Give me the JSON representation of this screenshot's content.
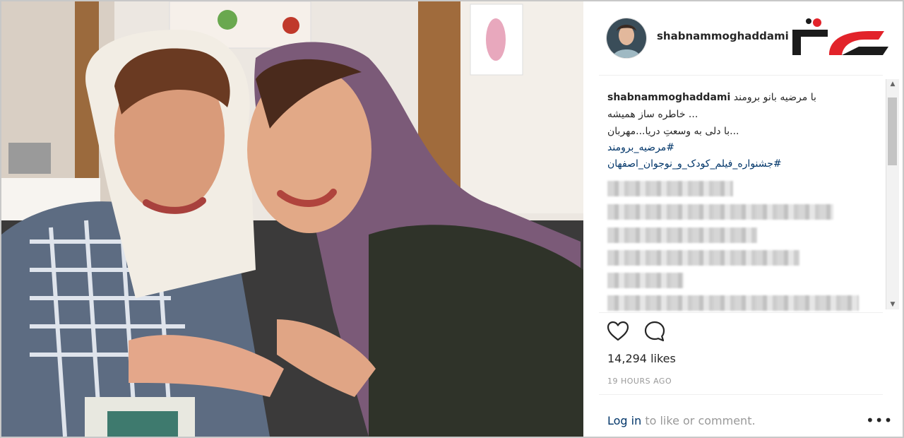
{
  "post": {
    "username": "shabnammoghaddami",
    "caption_user": "shabnammoghaddami",
    "caption_lines": [
      "با مرضیه بانو برومند",
      "... خاطره ساز همیشه",
      "...با دلی به وسعتِ دریا...مهربان"
    ],
    "hashtags": [
      "#مرضیه_برومند",
      "#جشنواره_فیلم_کودک_و_نوجوان_اصفهان"
    ],
    "likes": "14,294 likes",
    "time": "19 HOURS AGO",
    "login_link": "Log in",
    "login_rest": " to like or comment.",
    "more": "•••"
  },
  "icons": {
    "like": "heart-icon",
    "comment": "comment-bubble-icon",
    "more": "more-options-icon"
  },
  "colors": {
    "link": "#003569",
    "text": "#262626",
    "muted": "#999999",
    "logo_red": "#e2232a"
  }
}
